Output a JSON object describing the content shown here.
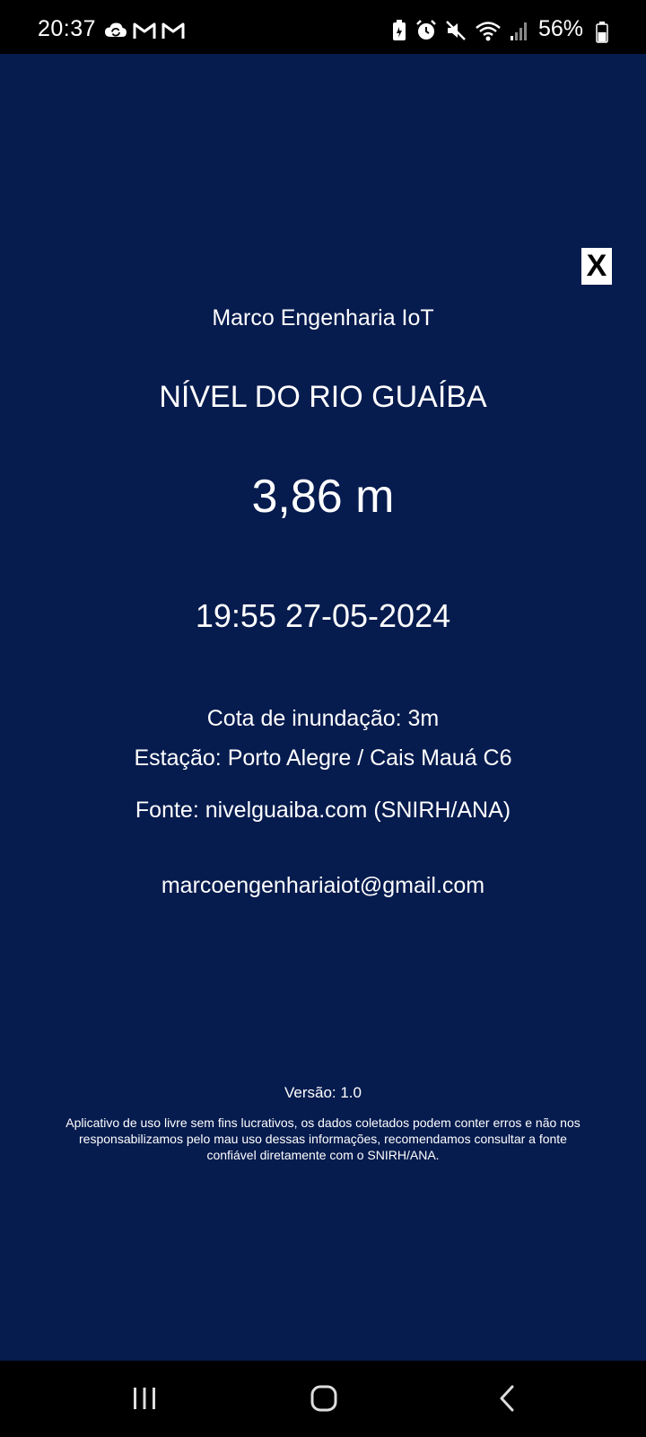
{
  "status_bar": {
    "time": "20:37",
    "battery_percent": "56%",
    "left_icons": [
      "cloud-sync-icon",
      "gmail-icon",
      "gmail-icon"
    ],
    "right_icons": [
      "battery-saver-icon",
      "alarm-icon",
      "mute-icon",
      "wifi-icon",
      "signal-icon"
    ],
    "battery_level": 0.56
  },
  "main": {
    "close_label": "X",
    "company": "Marco Engenharia IoT",
    "title": "NÍVEL DO RIO GUAÍBA",
    "level": "3,86 m",
    "datetime": "19:55 27-05-2024",
    "flood_level": "Cota de inundação: 3m",
    "station": "Estação: Porto Alegre / Cais Mauá C6",
    "source": "Fonte: nivelguaiba.com (SNIRH/ANA)",
    "email": "marcoengenhariaiot@gmail.com",
    "version": "Versão: 1.0",
    "disclaimer": "Aplicativo de uso livre sem fins lucrativos, os dados coletados podem conter erros e não nos responsabilizamos pelo mau uso dessas informações, recomendamos consultar a fonte confiável diretamente com o SNIRH/ANA."
  },
  "nav_bar": {
    "buttons": [
      "recent-apps-icon",
      "home-icon",
      "back-icon"
    ]
  },
  "colors": {
    "background": "#061b4e",
    "text": "#ffffff",
    "bars": "#000000"
  }
}
